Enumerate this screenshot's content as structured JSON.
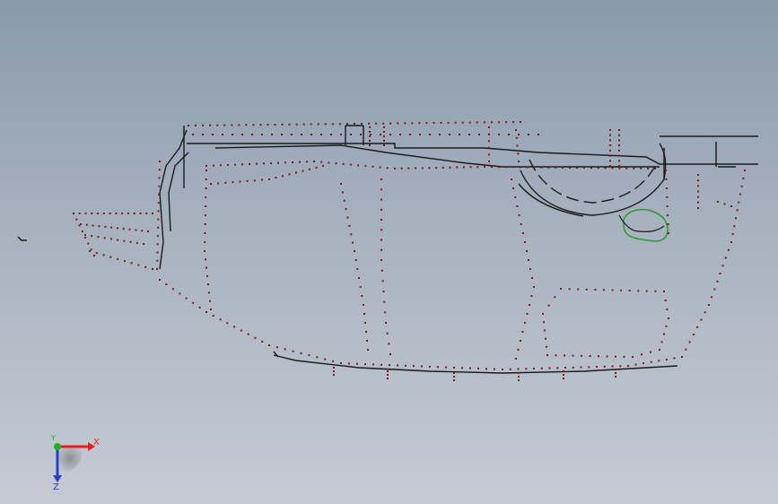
{
  "viewport": {
    "background_top": "#8a9aac",
    "background_bottom": "#c5cbd3"
  },
  "colors": {
    "outline": "#1a1a1a",
    "point": "#7a1a1a",
    "highlight": "#2e9a2e"
  },
  "triad": {
    "x_label": "X",
    "y_label": "Y",
    "z_label": "Z",
    "x_color": "#e02020",
    "y_color": "#20b020",
    "z_color": "#2040d0"
  }
}
